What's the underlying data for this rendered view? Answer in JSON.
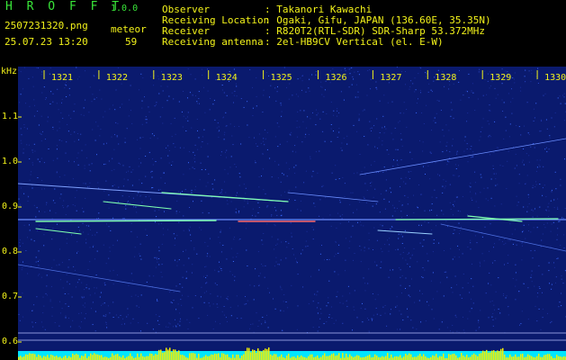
{
  "app": {
    "name": "H R O F F T",
    "version": "1.0.0",
    "filename": "2507231320.png",
    "datetime": "25.07.23 13:20",
    "meteor_label": "meteor",
    "meteor_count": "59"
  },
  "info": {
    "labels": [
      "Observer",
      "Receiving Location",
      "Receiver",
      "Receiving antenna"
    ],
    "values": [
      ": Takanori Kawachi",
      ": Ogaki, Gifu, JAPAN (136.60E, 35.35N)",
      ": R820T2(RTL-SDR) SDR-Sharp 53.372MHz",
      ": 2el-HB9CV Vertical (el. E-W)"
    ]
  },
  "axis": {
    "unit": "kHz",
    "y_ticks": [
      "1.1",
      "1.0",
      "0.9",
      "0.8",
      "0.7",
      "0.6"
    ],
    "x_ticks": [
      "1321",
      "1322",
      "1323",
      "1324",
      "1325",
      "1326",
      "1327",
      "1328",
      "1329",
      "1330"
    ]
  },
  "colors": {
    "background": "#0a1a6e",
    "grid": "#5a6aff",
    "text_green": "#39e639",
    "text_yellow": "#f2f21a",
    "meteor_trace": "#7fffb0",
    "bottom_bar_cyan": "#00e5ff",
    "bottom_bar_yellow": "#f5f000"
  }
}
